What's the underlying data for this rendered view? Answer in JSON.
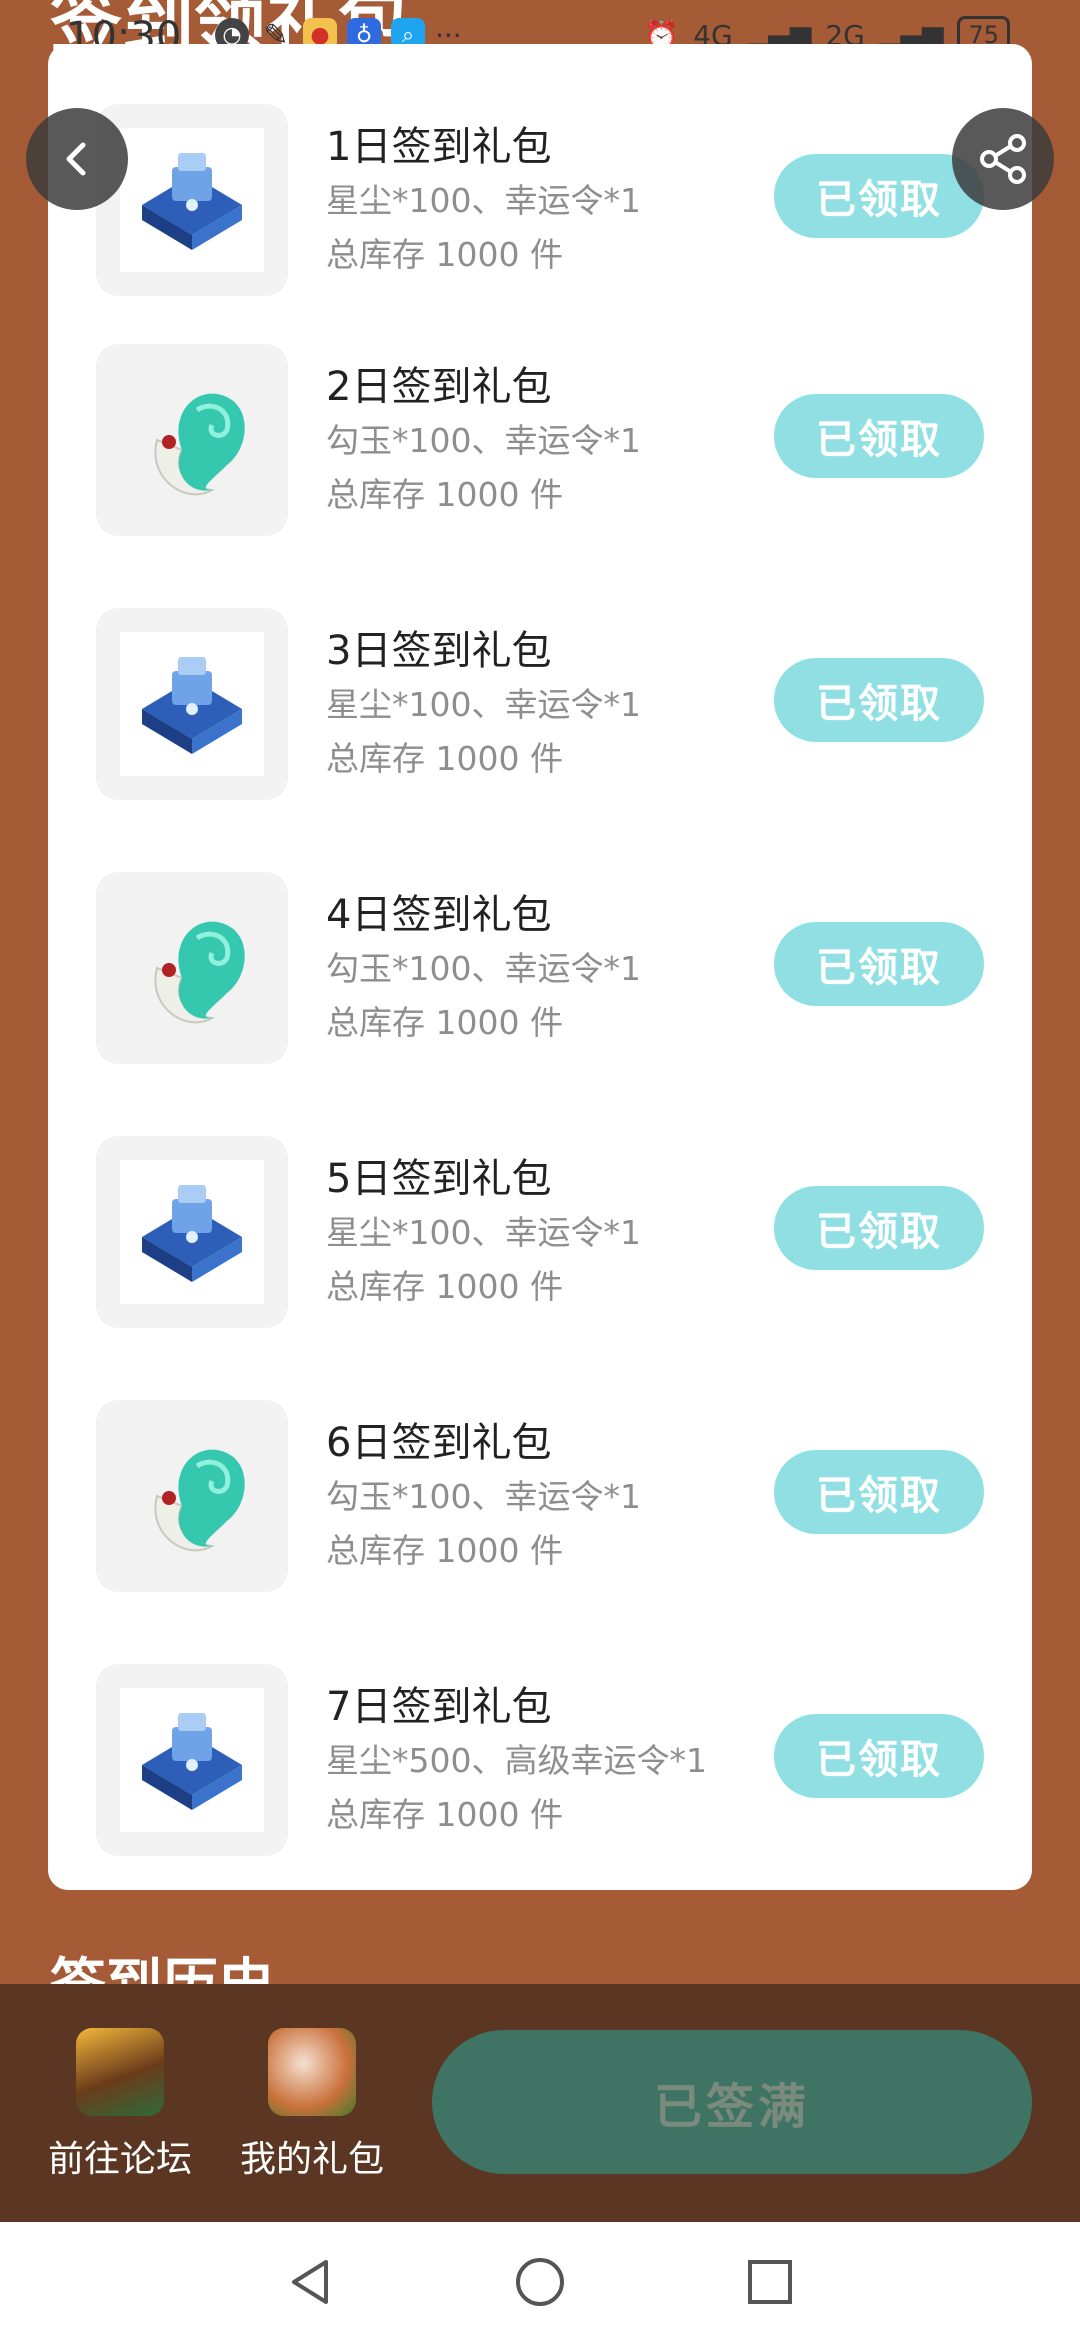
{
  "status_bar": {
    "time": "10:30",
    "net1": "4G",
    "net2": "2G",
    "battery": "75"
  },
  "page": {
    "title_peek": "签到领礼包",
    "section_peek": "签到历史"
  },
  "gifts": [
    {
      "title": "1日签到礼包",
      "content": "星尘*100、幸运令*1",
      "stock": "总库存 1000 件",
      "button": "已领取",
      "icon": "star-dust-chest"
    },
    {
      "title": "2日签到礼包",
      "content": "勾玉*100、幸运令*1",
      "stock": "总库存 1000 件",
      "button": "已领取",
      "icon": "magatama"
    },
    {
      "title": "3日签到礼包",
      "content": "星尘*100、幸运令*1",
      "stock": "总库存 1000 件",
      "button": "已领取",
      "icon": "star-dust-chest"
    },
    {
      "title": "4日签到礼包",
      "content": "勾玉*100、幸运令*1",
      "stock": "总库存 1000 件",
      "button": "已领取",
      "icon": "magatama"
    },
    {
      "title": "5日签到礼包",
      "content": "星尘*100、幸运令*1",
      "stock": "总库存 1000 件",
      "button": "已领取",
      "icon": "star-dust-chest"
    },
    {
      "title": "6日签到礼包",
      "content": "勾玉*100、幸运令*1",
      "stock": "总库存 1000 件",
      "button": "已领取",
      "icon": "magatama"
    },
    {
      "title": "7日签到礼包",
      "content": "星尘*500、高级幸运令*1",
      "stock": "总库存 1000 件",
      "button": "已领取",
      "icon": "star-dust-chest"
    }
  ],
  "bottom_bar": {
    "forum_label": "前往论坛",
    "my_gifts_label": "我的礼包",
    "signed_label": "已签满"
  },
  "colors": {
    "background": "#a55b35",
    "button_claimed": "#8fdfe3",
    "bottom_bar": "#5b3622",
    "signed_button": "#3f7465"
  }
}
